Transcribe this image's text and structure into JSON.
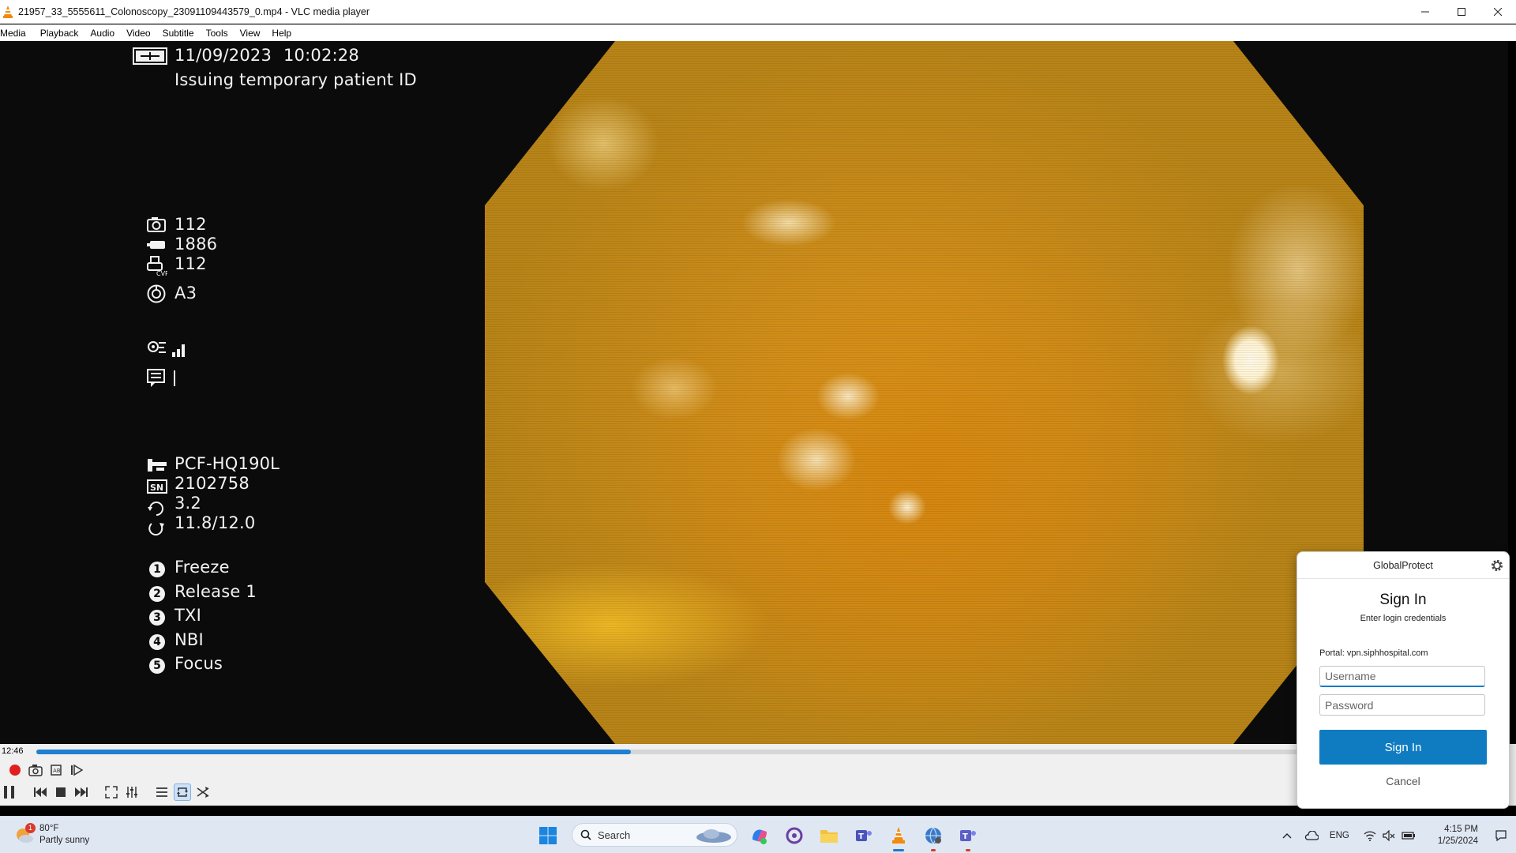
{
  "window": {
    "title": "21957_33_5555611_Colonoscopy_23091109443579_0.mp4 - VLC media player"
  },
  "menu": [
    "Media",
    "Playback",
    "Audio",
    "Video",
    "Subtitle",
    "Tools",
    "View",
    "Help"
  ],
  "overlay": {
    "date": "11/09/2023",
    "time": "10:02:28",
    "patient_msg": "Issuing temporary patient ID",
    "counters": [
      {
        "icon": "camera-icon",
        "value": "112"
      },
      {
        "icon": "battery-icon",
        "value": "1886"
      },
      {
        "icon": "printer-cvp-icon",
        "value": "112"
      },
      {
        "icon": "iris-icon",
        "value": "A3"
      }
    ],
    "scope_info": [
      {
        "icon": "scope-model-icon",
        "value": "PCF-HQ190L"
      },
      {
        "icon": "serial-number-icon",
        "value": "2102758"
      },
      {
        "icon": "rotation-icon",
        "value": "3.2"
      },
      {
        "icon": "cycle-icon",
        "value": "11.8/12.0"
      }
    ],
    "buttons": [
      {
        "num": "1",
        "label": "Freeze"
      },
      {
        "num": "2",
        "label": "Release 1"
      },
      {
        "num": "3",
        "label": "TXI"
      },
      {
        "num": "4",
        "label": "NBI"
      },
      {
        "num": "5",
        "label": "Focus"
      }
    ]
  },
  "player": {
    "current_time": "12:46",
    "progress_percent": 40.4
  },
  "globalprotect": {
    "header": "GlobalProtect",
    "title": "Sign In",
    "subtitle": "Enter login credentials",
    "portal": "Portal: vpn.siphhospital.com",
    "username_placeholder": "Username",
    "password_placeholder": "Password",
    "signin_label": "Sign In",
    "cancel_label": "Cancel"
  },
  "taskbar": {
    "weather_temp": "80°F",
    "weather_desc": "Partly sunny",
    "weather_badge": "1",
    "search_label": "Search",
    "lang": "ENG",
    "time": "4:15 PM",
    "date": "1/25/2024"
  },
  "colors": {
    "accent": "#0f7cc2",
    "seek": "#1f7fd4",
    "video_bg": "#0b0b0c",
    "scope": "#d99a22"
  }
}
